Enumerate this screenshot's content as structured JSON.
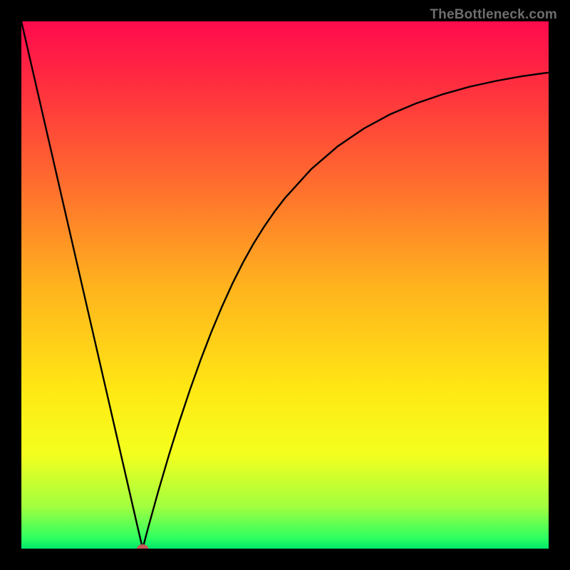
{
  "watermark": "TheBottleneck.com",
  "chart_data": {
    "type": "line",
    "title": "",
    "xlabel": "",
    "ylabel": "",
    "xlim": [
      0,
      100
    ],
    "ylim": [
      0,
      100
    ],
    "x": [
      0,
      2,
      4,
      6,
      8,
      10,
      12,
      14,
      16,
      18,
      20,
      22,
      23,
      24,
      26,
      28,
      30,
      32,
      34,
      36,
      38,
      40,
      42,
      44,
      46,
      48,
      50,
      55,
      60,
      65,
      70,
      75,
      80,
      85,
      90,
      95,
      100
    ],
    "values": [
      100,
      91.3,
      82.6,
      73.9,
      65.2,
      56.5,
      47.8,
      39.1,
      30.4,
      21.7,
      13.0,
      4.3,
      0.0,
      3.8,
      11.0,
      17.8,
      24.2,
      30.2,
      35.8,
      41.0,
      45.8,
      50.2,
      54.2,
      57.8,
      61.0,
      63.9,
      66.5,
      72.0,
      76.3,
      79.7,
      82.4,
      84.5,
      86.2,
      87.6,
      88.7,
      89.6,
      90.3
    ],
    "min_point": {
      "x": 23,
      "y": 0
    },
    "gradient_stops": [
      {
        "offset": 0.0,
        "color": "#ff0a4d"
      },
      {
        "offset": 0.12,
        "color": "#ff2e3f"
      },
      {
        "offset": 0.3,
        "color": "#ff6a2f"
      },
      {
        "offset": 0.5,
        "color": "#ffb21e"
      },
      {
        "offset": 0.7,
        "color": "#ffe814"
      },
      {
        "offset": 0.82,
        "color": "#f4ff1e"
      },
      {
        "offset": 0.92,
        "color": "#a2ff3f"
      },
      {
        "offset": 0.98,
        "color": "#2dff60"
      },
      {
        "offset": 1.0,
        "color": "#00e66a"
      }
    ],
    "curve_color": "#000000",
    "marker_color": "#c45a5a"
  }
}
